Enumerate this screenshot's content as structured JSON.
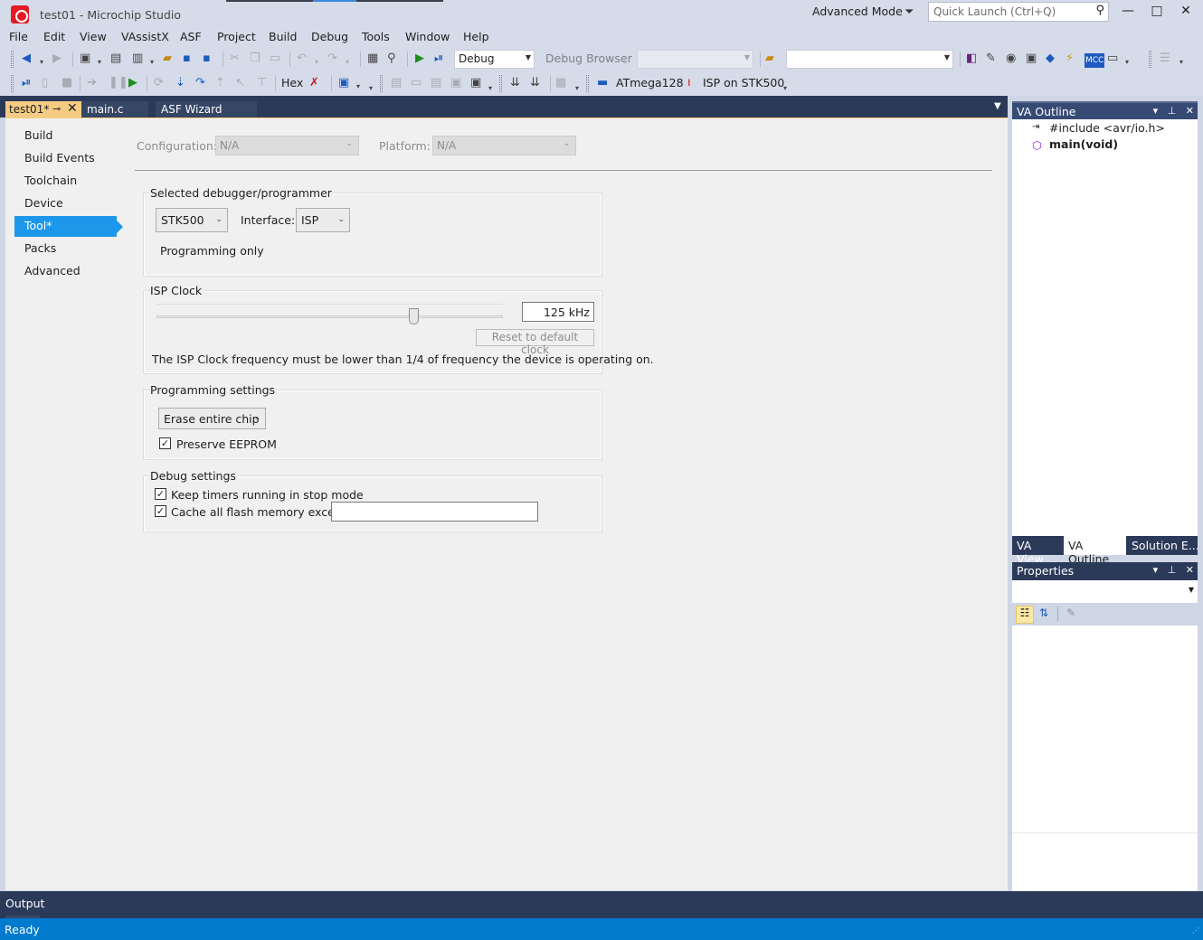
{
  "window": {
    "title": "test01 - Microchip Studio",
    "mode_label": "Advanced Mode",
    "quick_launch_placeholder": "Quick Launch (Ctrl+Q)",
    "minimize": "—",
    "maximize": "□",
    "close": "✕"
  },
  "menu": [
    "File",
    "Edit",
    "View",
    "VAssistX",
    "ASF",
    "Project",
    "Build",
    "Debug",
    "Tools",
    "Window",
    "Help"
  ],
  "toolbar1": {
    "configuration_value": "Debug",
    "debug_browser_label": "Debug Browser",
    "platform_value": "",
    "search_value": ""
  },
  "toolbar2": {
    "hex_label": "Hex",
    "device_label": "ATmega128",
    "tool_label": "ISP on STK500"
  },
  "tabs": {
    "active": "test01*",
    "main_c": "main.c",
    "asf_wizard": "ASF Wizard"
  },
  "nav": [
    "Build",
    "Build Events",
    "Toolchain",
    "Device",
    "Tool*",
    "Packs",
    "Advanced"
  ],
  "config": {
    "configuration_label": "Configuration:",
    "configuration_value": "N/A",
    "platform_label": "Platform:",
    "platform_value": "N/A"
  },
  "debugger_group": {
    "title": "Selected debugger/programmer",
    "tool_value": "STK500",
    "interface_label": "Interface:",
    "interface_value": "ISP",
    "mode_text": "Programming only"
  },
  "isp_clock": {
    "title": "ISP Clock",
    "value": "125 kHz",
    "slider_level_fraction": 0.75,
    "reset_label": "Reset to default clock",
    "note": "The ISP Clock frequency must be lower than 1/4 of frequency the device is operating on."
  },
  "programming_settings": {
    "title": "Programming settings",
    "erase_value": "Erase entire chip",
    "preserve_eeprom_label": "Preserve EEPROM",
    "preserve_eeprom_checked": true
  },
  "debug_settings": {
    "title": "Debug settings",
    "keep_timers_label": "Keep timers running in stop mode",
    "keep_timers_checked": true,
    "cache_flash_label": "Cache all flash memory except",
    "cache_flash_checked": true,
    "cache_flash_value": ""
  },
  "va_outline": {
    "title": "VA Outline",
    "items": [
      "#include <avr/io.h>",
      "main(void)"
    ],
    "tabs": [
      "VA View",
      "VA Outline",
      "Solution E..."
    ]
  },
  "properties": {
    "title": "Properties"
  },
  "output": {
    "tab_label": "Output"
  },
  "status": {
    "text": "Ready"
  },
  "colors": {
    "accent": "#007acc",
    "selection": "#1c97ea",
    "active_tab": "#f5cc84",
    "panel_header": "#2c3a5a"
  }
}
